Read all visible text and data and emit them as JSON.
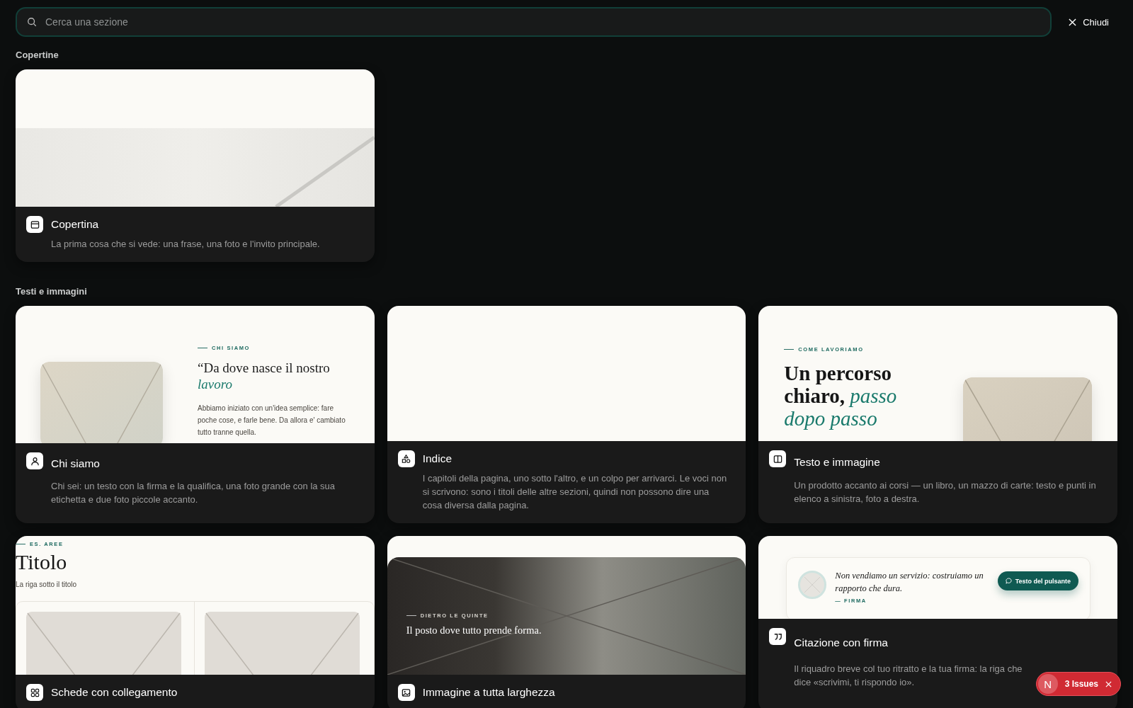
{
  "search": {
    "placeholder": "Cerca una sezione"
  },
  "close_button": {
    "label": "Chiudi"
  },
  "groups": [
    {
      "title": "Copertine",
      "cards": [
        {
          "kind": "cover",
          "title": "Copertina",
          "description": "La prima cosa che si vede: una frase, una foto e l'invito principale."
        }
      ]
    },
    {
      "title": "Testi e immagini",
      "cards": [
        {
          "kind": "about",
          "title": "Chi siamo",
          "description": "Chi sei: un testo con la firma e la qualifica, una foto grande con la sua etichetta e due foto piccole accanto.",
          "preview": {
            "eyebrow": "CHI SIAMO",
            "heading": "“Da dove nasce il nostro *lavoro*",
            "body": "Abbiamo iniziato con un'idea semplice: fare poche cose, e farle bene. Da allora e' cambiato tutto tranne quella."
          }
        },
        {
          "kind": "index",
          "title": "Indice",
          "description": "I capitoli della pagina, uno sotto l'altro, e un colpo per arrivarci. Le voci non si scrivono: sono i titoli delle altre sezioni, quindi non possono dire una cosa diversa dalla pagina."
        },
        {
          "kind": "text_image",
          "title": "Testo e immagine",
          "description": "Un prodotto accanto ai corsi — un libro, un mazzo di carte: testo e punti in elenco a sinistra, foto a destra.",
          "preview": {
            "eyebrow": "COME LAVORIAMO",
            "heading": "Un percorso chiaro, *passo dopo passo*"
          }
        },
        {
          "kind": "cards",
          "title": "Schede con collegamento",
          "preview": {
            "eyebrow": "ES. AREE",
            "heading": "Titolo",
            "body": "La riga sotto il titolo"
          }
        },
        {
          "kind": "fullwidth",
          "title": "Immagine a tutta larghezza",
          "preview": {
            "eyebrow": "DIETRO LE QUINTE",
            "heading": "Il posto dove tutto prende forma."
          }
        },
        {
          "kind": "quote",
          "title": "Citazione con firma",
          "description": "Il riquadro breve col tuo ritratto e la tua firma: la riga che dice «scrivimi, ti rispondo io».",
          "preview": {
            "quote": "Non vendiamo un servizio: costruiamo un rapporto che dura.",
            "signature": "— FIRMA",
            "button": "Testo del pulsante"
          }
        }
      ]
    }
  ],
  "issues_badge": {
    "avatar": "N",
    "label": "3 Issues"
  }
}
